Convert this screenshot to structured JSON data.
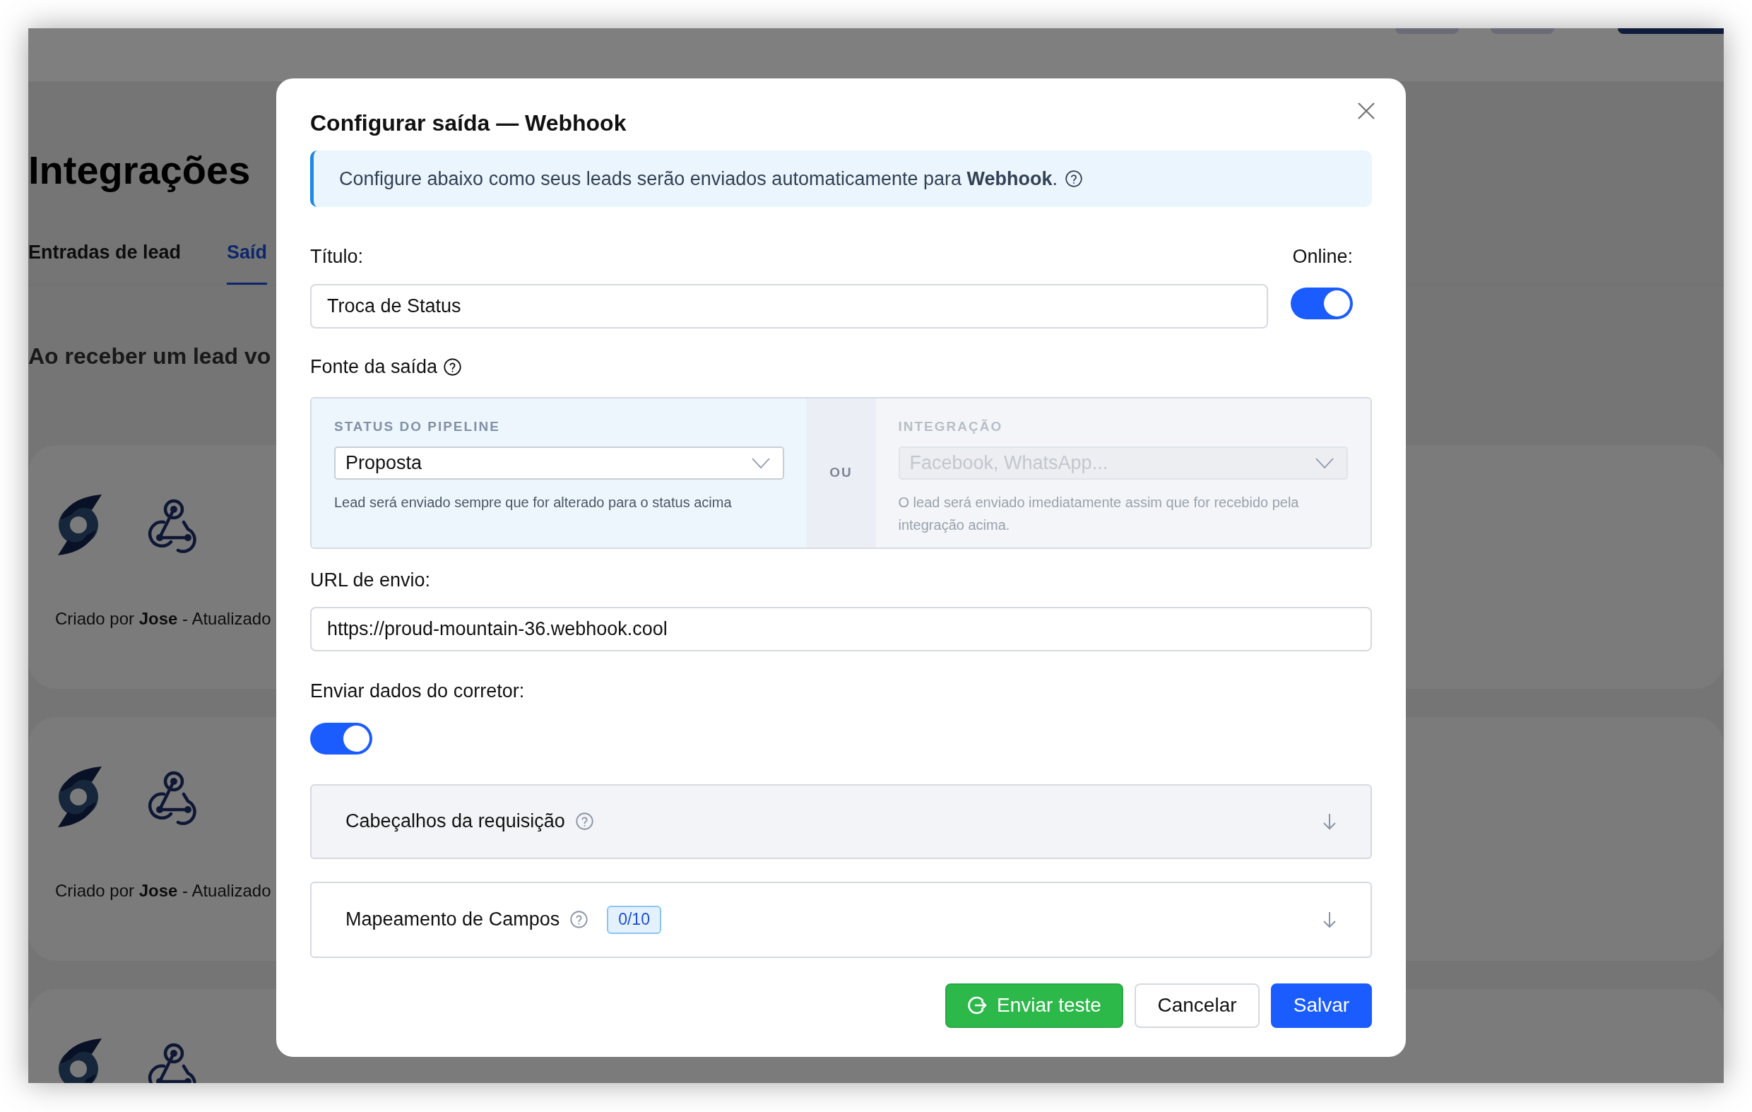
{
  "background": {
    "page_title": "Integrações",
    "tabs": [
      {
        "label": "Entradas de lead",
        "selected": false
      },
      {
        "label": "Saíd",
        "selected": true
      }
    ],
    "intro": "Ao receber um lead vo",
    "cards": [
      {
        "kind": "full",
        "caption": "Criado por **Jose** - Atualizado"
      },
      {
        "kind": "full",
        "caption": "Criado por **Jose** - Atualizado"
      },
      {
        "kind": "partial"
      }
    ]
  },
  "modal": {
    "title": "Configurar saída — Webhook",
    "info": "Configure abaixo como seus leads serão enviados automaticamente para **Webhook**.",
    "title_label": "Título:",
    "title_value": "Troca de Status",
    "online_label": "Online:",
    "online": {
      "on": true
    },
    "source_label": "Fonte da saída",
    "sources": [
      {
        "label": "STATUS DO PIPELINE",
        "value": "Proposta",
        "hint": "Lead será enviado sempre que for alterado para o status acima",
        "disabled": false
      },
      {
        "label": "INTEGRAÇÃO",
        "placeholder": "Facebook, WhatsApp...",
        "hint": "O lead será enviado imediatamente assim que for recebido pela integração acima.",
        "disabled": true
      }
    ],
    "or_label": "OU",
    "url_label": "URL de envio:",
    "url_value": "https://proud-mountain-36.webhook.cool",
    "broker_label": "Enviar dados do corretor:",
    "broker": {
      "on": true
    },
    "accordions": [
      {
        "label": "Cabeçalhos da requisição",
        "hovered": true,
        "expanded": false
      },
      {
        "label": "Mapeamento de Campos",
        "badge": "0/10",
        "hovered": false,
        "expanded": false
      }
    ],
    "buttons": [
      {
        "kind": "test",
        "label": "Enviar teste"
      },
      {
        "kind": "cancel",
        "label": "Cancelar"
      },
      {
        "kind": "save",
        "label": "Salvar"
      }
    ]
  }
}
